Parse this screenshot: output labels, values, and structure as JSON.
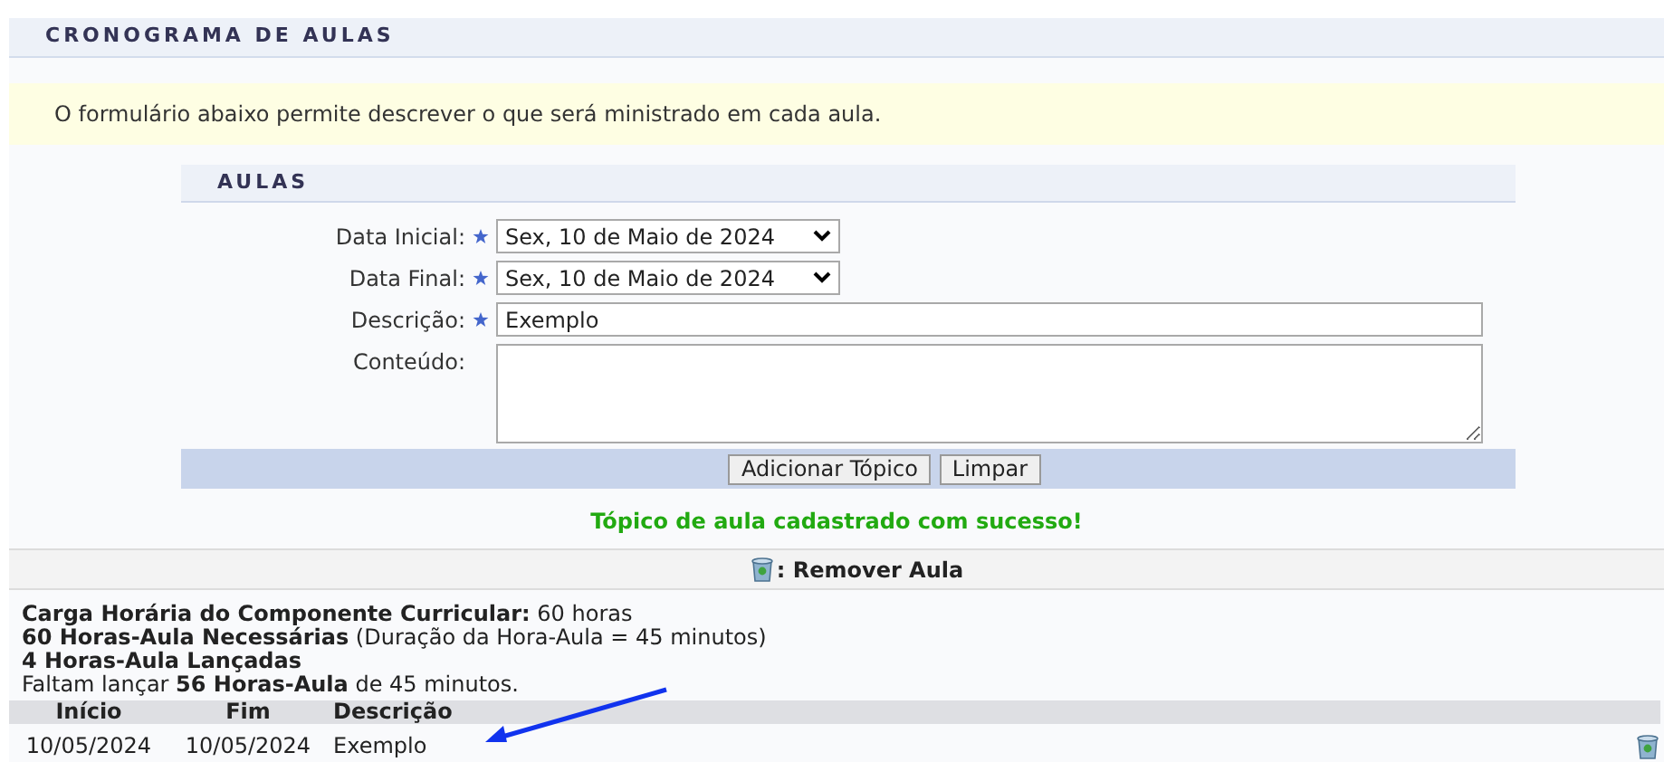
{
  "page_title": "CRONOGRAMA DE AULAS",
  "notice": "O formulário abaixo permite descrever o que será ministrado em cada aula.",
  "form": {
    "title": "AULAS",
    "fields": [
      {
        "kind": "select",
        "label": "Data Inicial:",
        "required": true,
        "value": "Sex, 10 de Maio de 2024"
      },
      {
        "kind": "select",
        "label": "Data Final:",
        "required": true,
        "value": "Sex, 10 de Maio de 2024"
      },
      {
        "kind": "text",
        "label": "Descrição:",
        "required": true,
        "value": "Exemplo"
      },
      {
        "kind": "textarea",
        "label": "Conteúdo:",
        "required": false
      }
    ],
    "buttons": [
      "Adicionar Tópico",
      "Limpar"
    ]
  },
  "success_message": "Tópico de aula cadastrado com sucesso!",
  "legend": ": Remover Aula",
  "summary": [
    "**Carga Horária do Componente Curricular:** 60 horas",
    "**60 Horas-Aula Necessárias** (Duração da Hora-Aula = 45 minutos)",
    "**4 Horas-Aula Lançadas**",
    "Faltam lançar **56 Horas-Aula** de 45 minutos."
  ],
  "table": {
    "columns": [
      "Início",
      "Fim",
      "Descrição"
    ],
    "rows": [
      [
        "10/05/2024",
        "10/05/2024",
        "Exemplo"
      ]
    ]
  }
}
